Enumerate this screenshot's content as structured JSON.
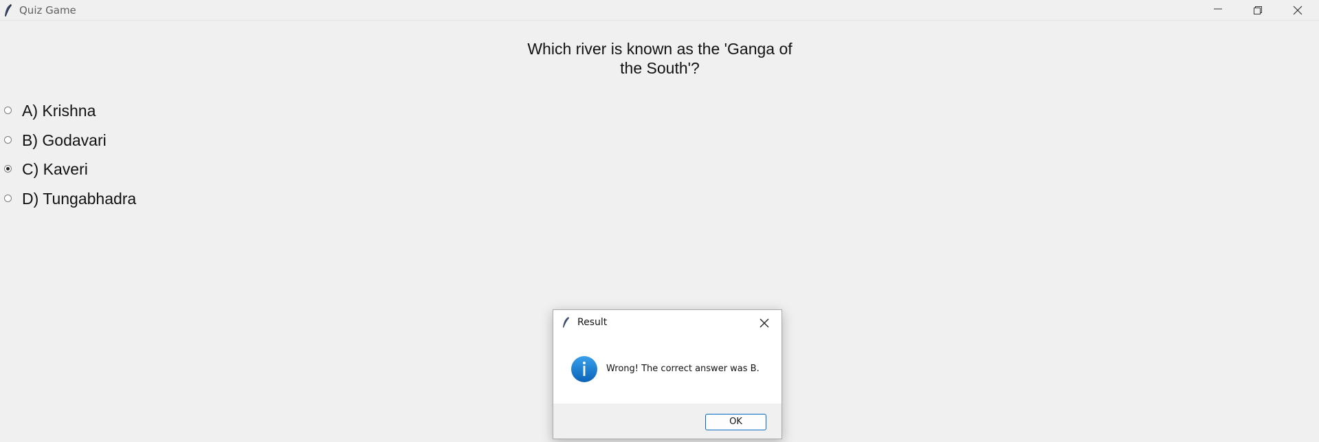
{
  "window": {
    "title": "Quiz Game",
    "icon": "feather-icon",
    "controls": [
      "minimize-icon",
      "restore-icon",
      "close-icon"
    ]
  },
  "quiz": {
    "question": "Which river is known as the 'Ganga of the South'?",
    "options": [
      {
        "label": "A) Krishna",
        "selected": false
      },
      {
        "label": "B) Godavari",
        "selected": false
      },
      {
        "label": "C) Kaveri",
        "selected": true
      },
      {
        "label": "D) Tungabhadra",
        "selected": false
      }
    ]
  },
  "dialog": {
    "title": "Result",
    "icon": "info-icon",
    "message": "Wrong! The correct answer was B.",
    "ok_label": "OK"
  },
  "colors": {
    "background": "#f0f0f0",
    "accent": "#0067c0",
    "info_blue": "#1a7fd6"
  }
}
